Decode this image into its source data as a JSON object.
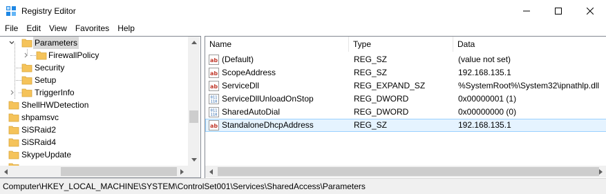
{
  "window": {
    "title": "Registry Editor",
    "minimize_glyph": "—",
    "maximize_glyph": "☐",
    "close_glyph": "✕"
  },
  "menu": [
    "File",
    "Edit",
    "View",
    "Favorites",
    "Help"
  ],
  "tree": {
    "items": [
      {
        "label": "Parameters",
        "selected": true,
        "expander": "expanded"
      },
      {
        "label": "FirewallPolicy",
        "expander": "collapsed"
      },
      {
        "label": "Security"
      },
      {
        "label": "Setup"
      },
      {
        "label": "TriggerInfo",
        "expander": "collapsed"
      },
      {
        "label": "ShellHWDetection"
      },
      {
        "label": "shpamsvc"
      },
      {
        "label": "SiSRaid2"
      },
      {
        "label": "SiSRaid4"
      },
      {
        "label": "SkypeUpdate"
      }
    ]
  },
  "list": {
    "columns": [
      "Name",
      "Type",
      "Data"
    ],
    "rows": [
      {
        "name": "(Default)",
        "type": "REG_SZ",
        "data": "(value not set)",
        "icon": "string-value-icon"
      },
      {
        "name": "ScopeAddress",
        "type": "REG_SZ",
        "data": "192.168.135.1",
        "icon": "string-value-icon"
      },
      {
        "name": "ServiceDll",
        "type": "REG_EXPAND_SZ",
        "data": "%SystemRoot%\\System32\\ipnathlp.dll",
        "icon": "string-value-icon"
      },
      {
        "name": "ServiceDllUnloadOnStop",
        "type": "REG_DWORD",
        "data": "0x00000001 (1)",
        "icon": "binary-value-icon"
      },
      {
        "name": "SharedAutoDial",
        "type": "REG_DWORD",
        "data": "0x00000000 (0)",
        "icon": "binary-value-icon"
      },
      {
        "name": "StandaloneDhcpAddress",
        "type": "REG_SZ",
        "data": "192.168.135.1",
        "icon": "string-value-icon",
        "selected": true
      }
    ]
  },
  "status": {
    "path": "Computer\\HKEY_LOCAL_MACHINE\\SYSTEM\\ControlSet001\\Services\\SharedAccess\\Parameters"
  },
  "colors": {
    "folder": "#f5c35a",
    "selection_bg": "#e5f3ff",
    "selection_border": "#99d1ff",
    "string_icon": "#c0392b",
    "binary_icon": "#1f5fa8"
  }
}
